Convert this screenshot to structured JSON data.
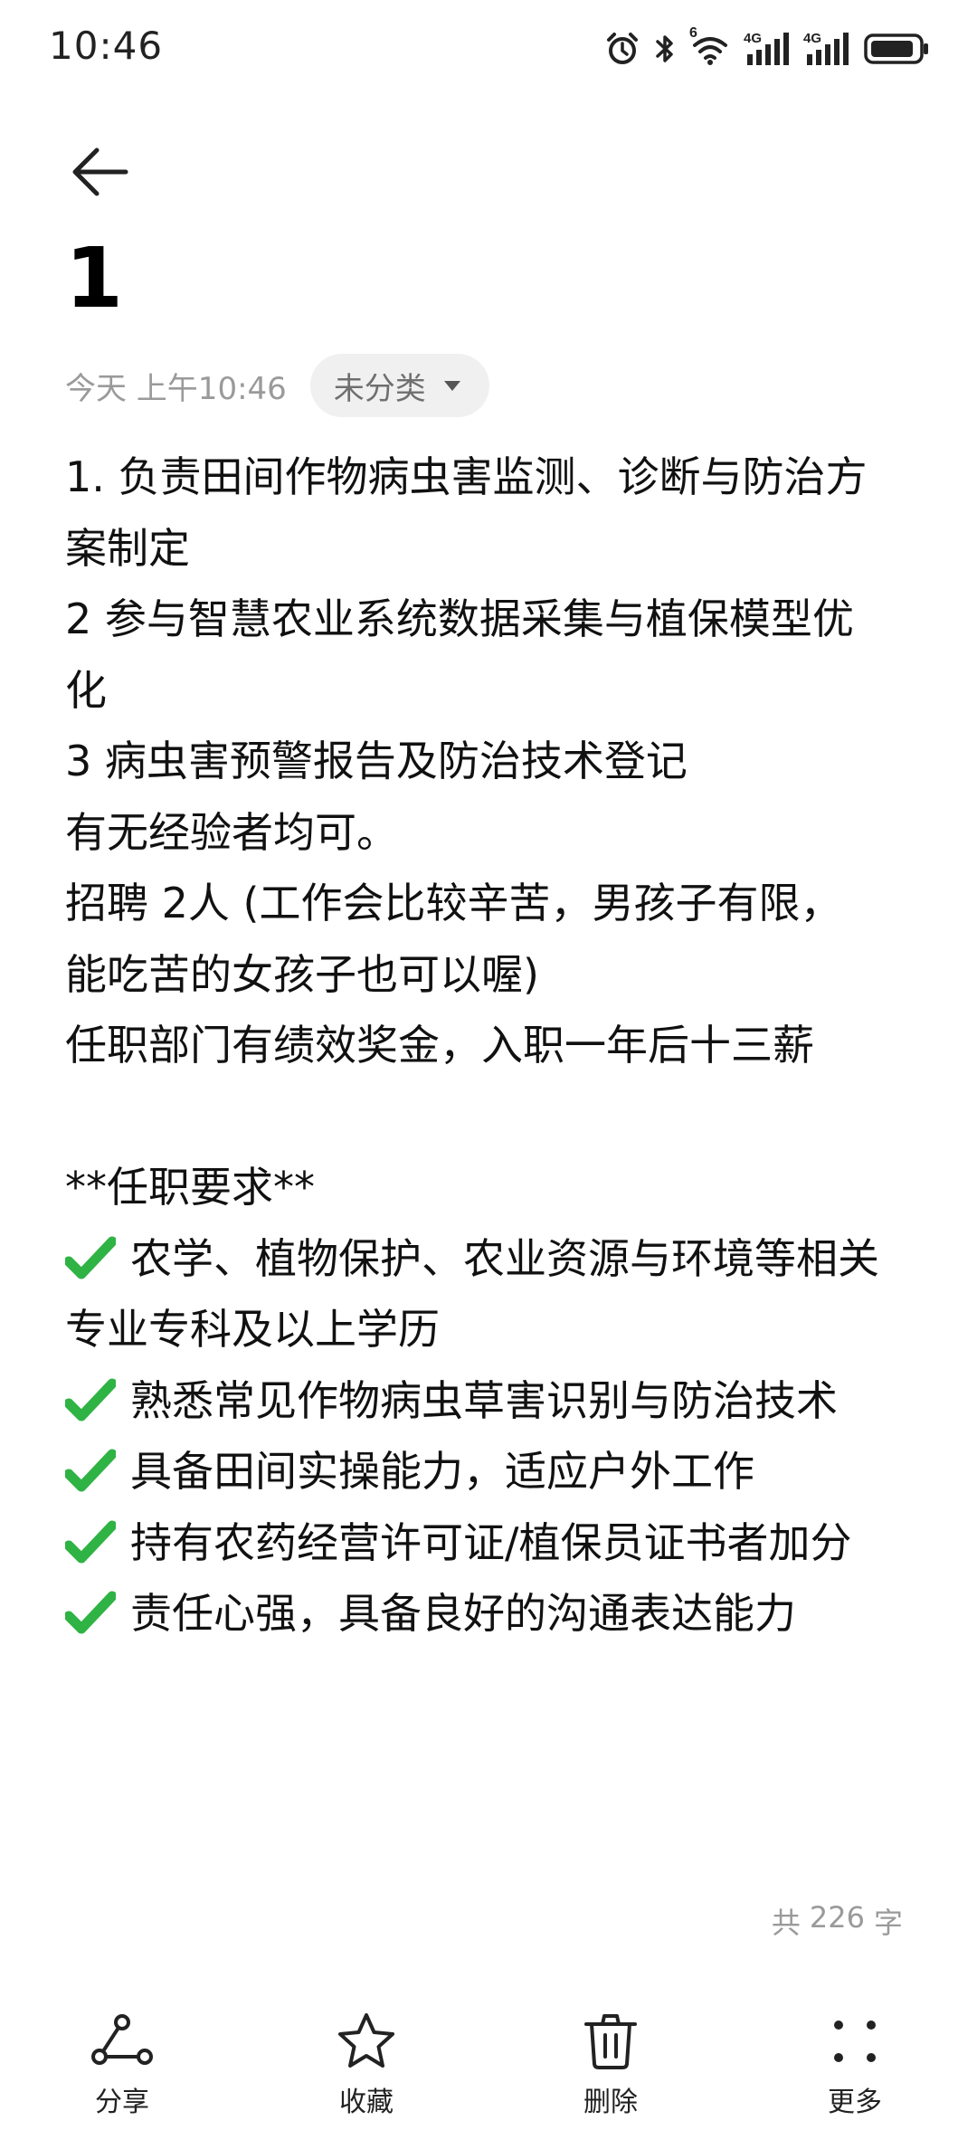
{
  "status_bar": {
    "time": "10:46",
    "wifi_badge": "6",
    "signal_1": "4G",
    "signal_2": "4G",
    "icons": [
      "alarm-icon",
      "bluetooth-icon",
      "wifi-icon",
      "signal-icon",
      "signal-icon",
      "battery-icon"
    ]
  },
  "header": {
    "back_icon": "arrow-left-icon"
  },
  "note": {
    "title": "1",
    "date": "今天 上午10:46",
    "category": "未分类",
    "lines": [
      "1. 负责田间作物病虫害监测、诊断与防治方",
      "案制定",
      "2 参与智慧农业系统数据采集与植保模型优",
      "化",
      "3 病虫害预警报告及防治技术登记",
      "有无经验者均可。",
      "招聘  2人  (工作会比较辛苦，男孩子有限，",
      "能吃苦的女孩子也可以喔)",
      "任职部门有绩效奖金，入职一年后十三薪",
      "",
      "**任职要求**"
    ],
    "requirements": [
      {
        "text": "农学、植物保护、农业资源与环境等相关",
        "continuation": "专业专科及以上学历"
      },
      {
        "text": "熟悉常见作物病虫草害识别与防治技术"
      },
      {
        "text": "具备田间实操能力，适应户外工作"
      },
      {
        "text": "持有农药经营许可证/植保员证书者加分"
      },
      {
        "text": "责任心强，具备良好的沟通表达能力"
      }
    ],
    "check_icon": "check-mark-icon",
    "check_color": "#2fb344"
  },
  "word_count": {
    "prefix": "共",
    "count": "226",
    "suffix": "字"
  },
  "toolbar": {
    "share": "分享",
    "favorite": "收藏",
    "delete": "删除",
    "more": "更多"
  }
}
